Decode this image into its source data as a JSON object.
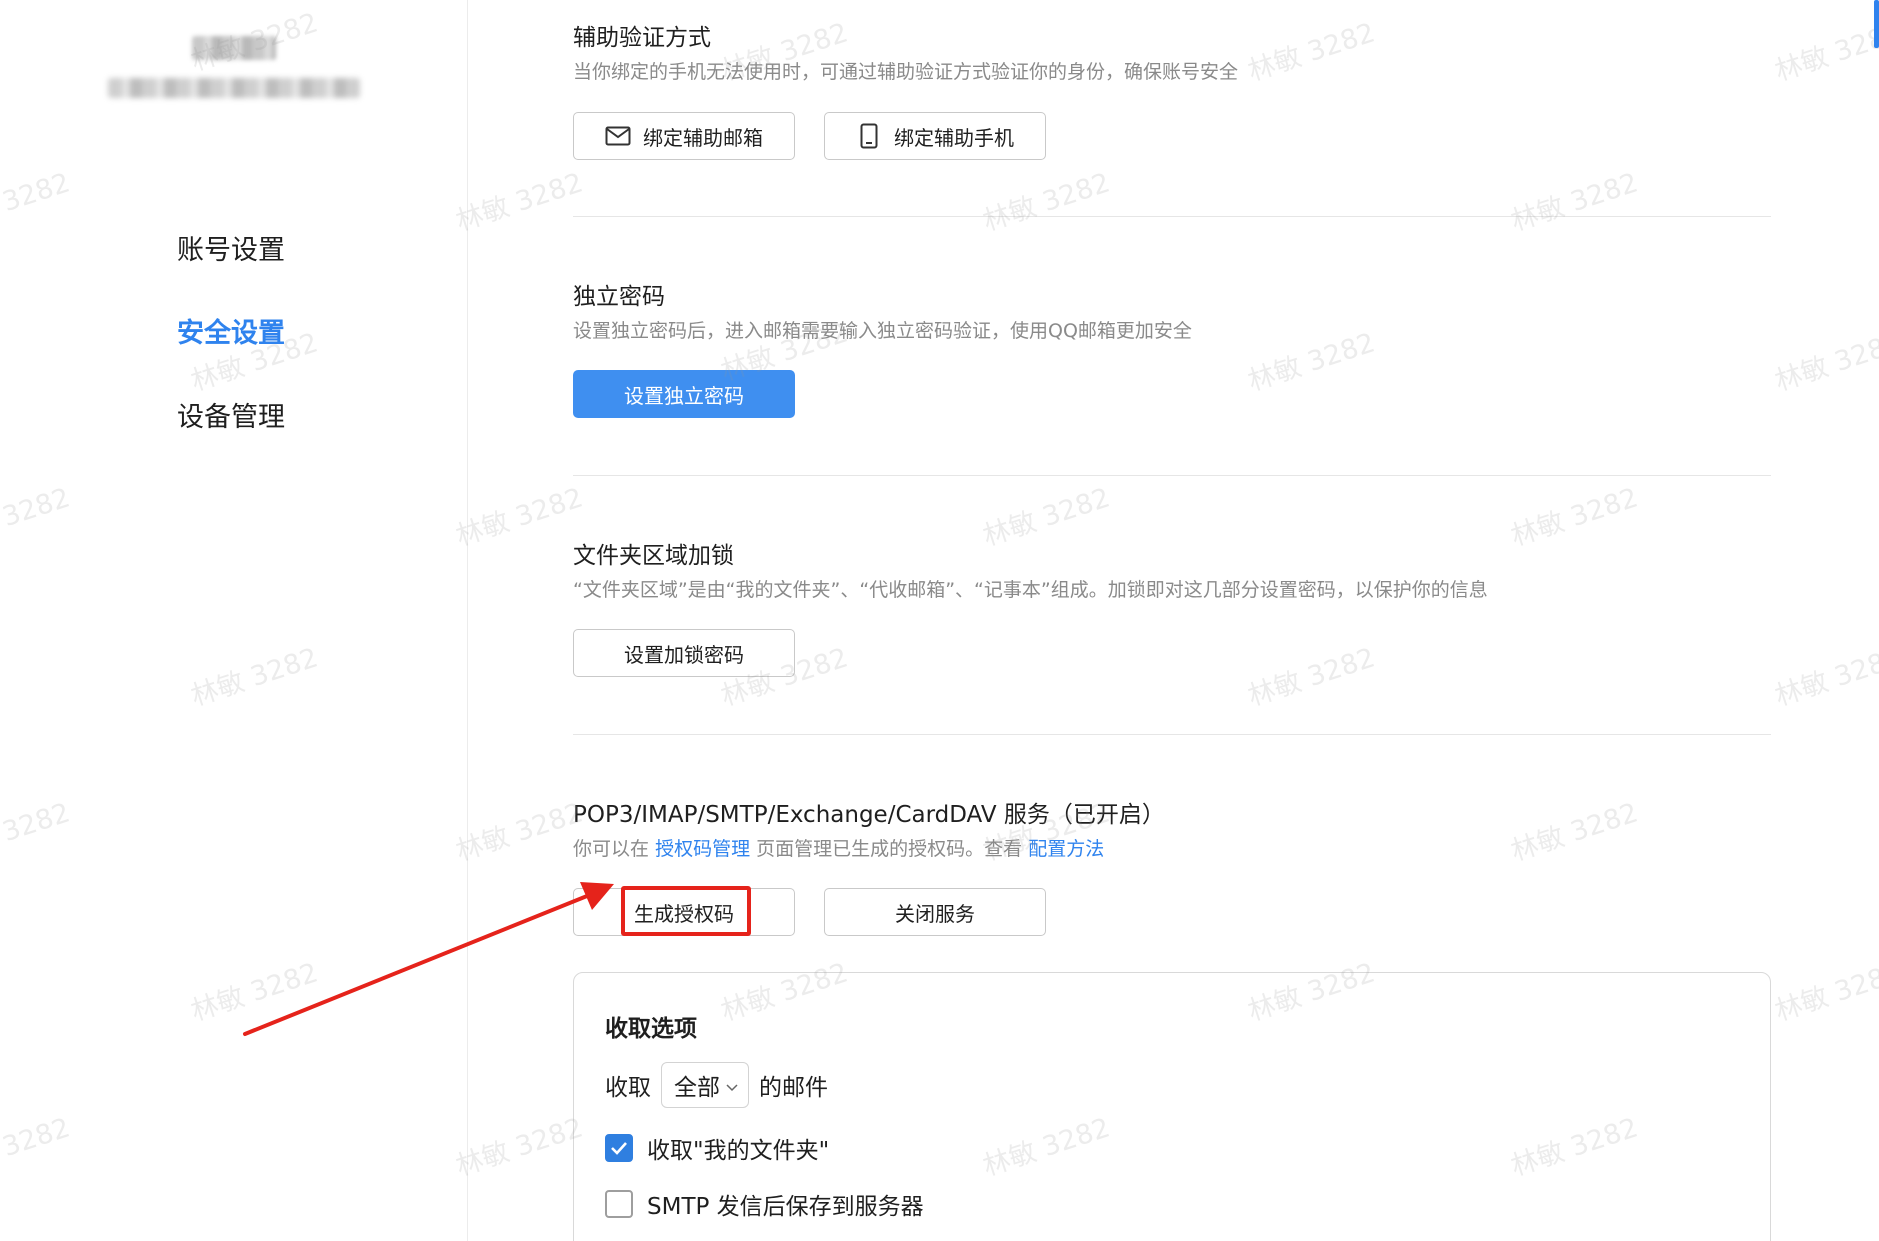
{
  "sidebar": {
    "nav": [
      {
        "label": "账号设置",
        "active": false
      },
      {
        "label": "安全设置",
        "active": true
      },
      {
        "label": "设备管理",
        "active": false
      }
    ]
  },
  "sections": {
    "secondary_verify": {
      "title": "辅助验证方式",
      "desc": "当你绑定的手机无法使用时，可通过辅助验证方式验证你的身份，确保账号安全",
      "bind_email_label": "绑定辅助邮箱",
      "bind_phone_label": "绑定辅助手机"
    },
    "independent_password": {
      "title": "独立密码",
      "desc": "设置独立密码后，进入邮箱需要输入独立密码验证，使用QQ邮箱更加安全",
      "button_label": "设置独立密码"
    },
    "folder_lock": {
      "title": "文件夹区域加锁",
      "desc": "“文件夹区域”是由“我的文件夹”、“代收邮箱”、“记事本”组成。加锁即对这几部分设置密码，以保护你的信息",
      "button_label": "设置加锁密码"
    },
    "pop3": {
      "title": "POP3/IMAP/SMTP/Exchange/CardDAV 服务（已开启）",
      "desc_prefix": "你可以在",
      "auth_link": "授权码管理",
      "desc_middle": "页面管理已生成的授权码。查看",
      "config_link": "配置方法",
      "generate_label": "生成授权码",
      "close_label": "关闭服务"
    }
  },
  "options": {
    "title": "收取选项",
    "fetch_prefix": "收取",
    "fetch_value": "全部",
    "fetch_suffix": "的邮件",
    "check_my_folders": {
      "label": "收取\"我的文件夹\"",
      "checked": true
    },
    "check_smtp_save": {
      "label": "SMTP 发信后保存到服务器",
      "checked": false
    }
  },
  "watermark": "林敏 3282",
  "colors": {
    "accent": "#2f83ee",
    "primary_button": "#3f8ff0",
    "annotation_red": "#e5231b"
  }
}
